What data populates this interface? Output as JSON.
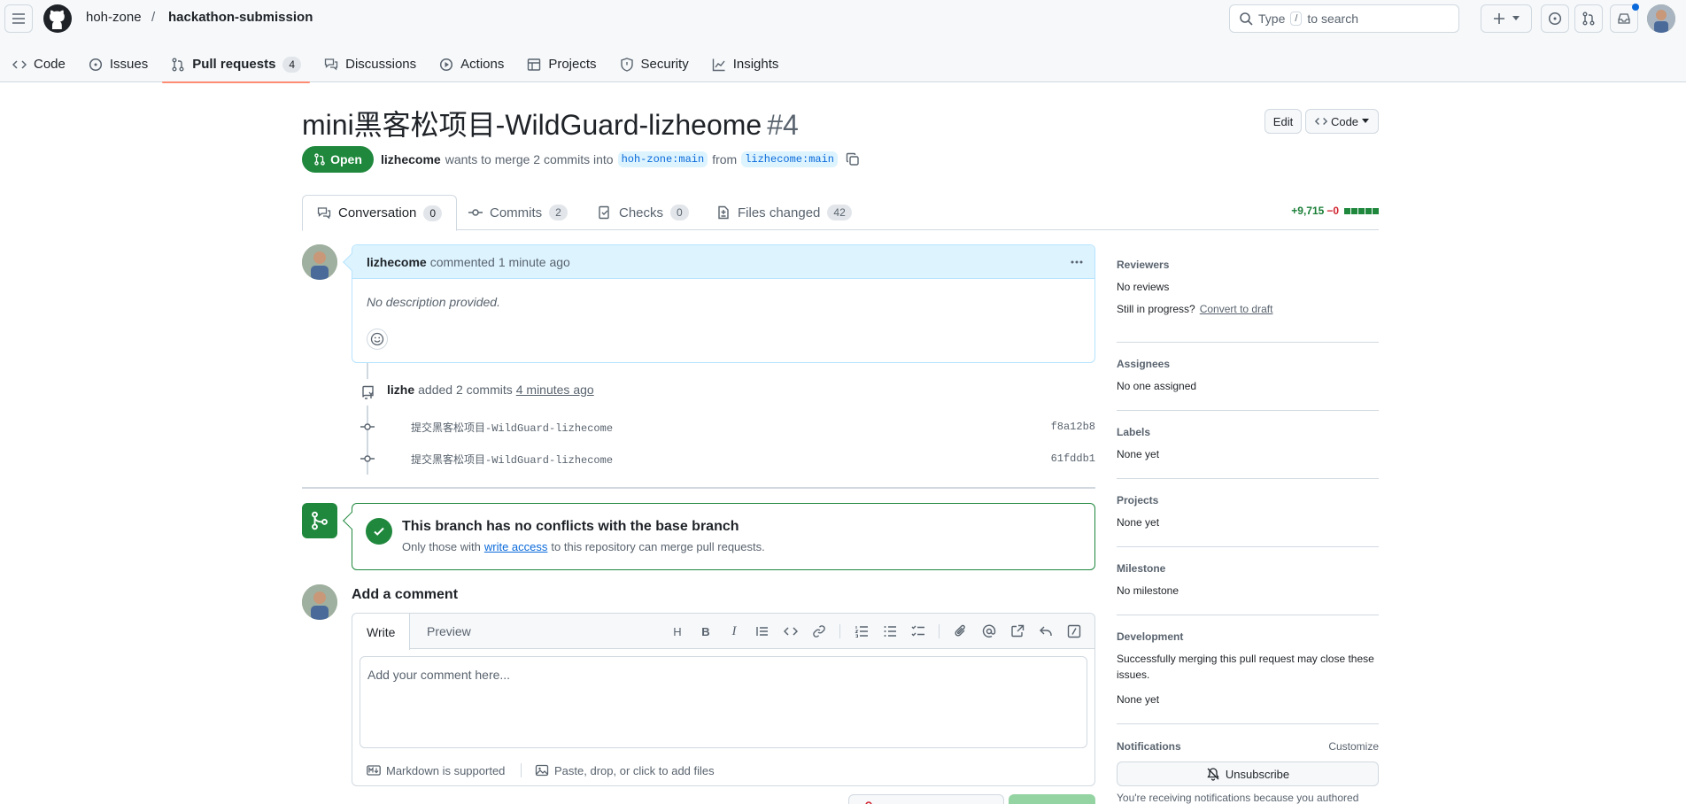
{
  "header": {
    "owner": "hoh-zone",
    "separator": "/",
    "repo": "hackathon-submission",
    "search_prefix": "Type",
    "search_key": "/",
    "search_suffix": "to search"
  },
  "repo_nav": [
    {
      "label": "Code",
      "icon": "code-icon"
    },
    {
      "label": "Issues",
      "icon": "issue-icon"
    },
    {
      "label": "Pull requests",
      "icon": "pull-request-icon",
      "count": "4",
      "active": true
    },
    {
      "label": "Discussions",
      "icon": "discussion-icon"
    },
    {
      "label": "Actions",
      "icon": "play-icon"
    },
    {
      "label": "Projects",
      "icon": "table-icon"
    },
    {
      "label": "Security",
      "icon": "shield-icon"
    },
    {
      "label": "Insights",
      "icon": "graph-icon"
    }
  ],
  "pr": {
    "title": "mini黑客松项目-WildGuard-lizheome",
    "number": "#4",
    "edit_label": "Edit",
    "code_label": "Code",
    "state": "Open",
    "author": "lizhecome",
    "meta_text": "wants to merge 2 commits into",
    "base_branch": "hoh-zone:main",
    "from_text": "from",
    "head_branch": "lizhecome:main"
  },
  "tabs": [
    {
      "label": "Conversation",
      "count": "0",
      "active": true
    },
    {
      "label": "Commits",
      "count": "2"
    },
    {
      "label": "Checks",
      "count": "0"
    },
    {
      "label": "Files changed",
      "count": "42"
    }
  ],
  "diffstat": {
    "additions": "+9,715",
    "deletions": "−0",
    "blocks": 5
  },
  "comment": {
    "author": "lizhecome",
    "action": "commented",
    "time": "1 minute ago",
    "body": "No description provided."
  },
  "commits_event": {
    "actor": "lizhe",
    "text": "added 2 commits",
    "time": "4 minutes ago",
    "commits": [
      {
        "message": "提交黑客松项目-WildGuard-lizhecome",
        "sha": "f8a12b8"
      },
      {
        "message": "提交黑客松项目-WildGuard-lizhecome",
        "sha": "61fddb1"
      }
    ]
  },
  "merge": {
    "title": "This branch has no conflicts with the base branch",
    "desc_pre": "Only those with",
    "desc_link": "write access",
    "desc_post": "to this repository can merge pull requests."
  },
  "add_comment": {
    "heading": "Add a comment",
    "write_tab": "Write",
    "preview_tab": "Preview",
    "placeholder": "Add your comment here...",
    "markdown_note": "Markdown is supported",
    "attach_note": "Paste, drop, or click to add files",
    "toolbar": [
      "H",
      "B",
      "I"
    ]
  },
  "sidebar": {
    "reviewers_h": "Reviewers",
    "reviewers_v": "No reviews",
    "progress_text": "Still in progress?",
    "progress_link": "Convert to draft",
    "assignees_h": "Assignees",
    "assignees_v": "No one assigned",
    "labels_h": "Labels",
    "labels_v": "None yet",
    "projects_h": "Projects",
    "projects_v": "None yet",
    "milestone_h": "Milestone",
    "milestone_v": "No milestone",
    "development_h": "Development",
    "development_desc": "Successfully merging this pull request may close these issues.",
    "development_v": "None yet",
    "notifications_h": "Notifications",
    "customize": "Customize",
    "unsubscribe": "Unsubscribe",
    "notif_note": "You're receiving notifications because you authored"
  },
  "colors": {
    "accent": "#0969da",
    "success": "#1f883d",
    "danger": "#d1242f",
    "nav_underline": "#fd8c73"
  }
}
